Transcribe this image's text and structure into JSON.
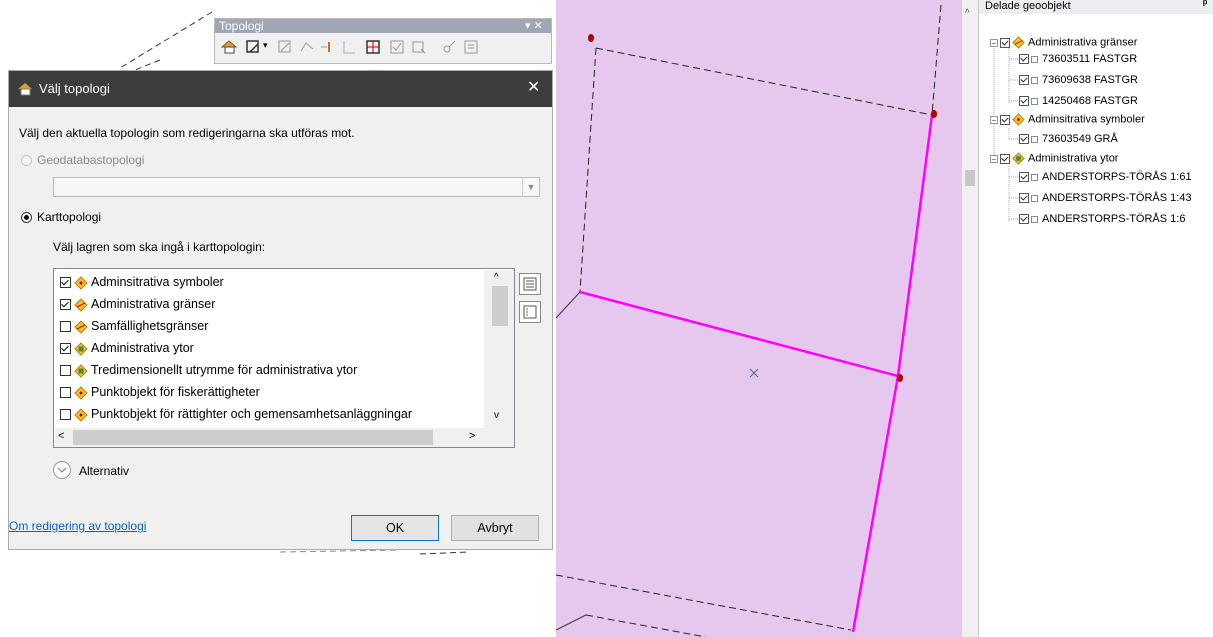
{
  "toolbar": {
    "title": "Topologi",
    "controls": "▾ ✕",
    "icons": [
      "topology-layer-icon",
      "topology-edit-tool-icon",
      "dropdown-arrow-icon",
      "modify-edge-icon",
      "reshape-edge-icon",
      "align-edge-icon",
      "generalize-icon",
      "show-shared-features-icon",
      "validate-icon",
      "error-inspector-icon",
      "fix-topology-icon",
      "topology-properties-icon"
    ]
  },
  "dialog": {
    "title": "Välj topologi",
    "close_glyph": "✕",
    "instruction": "Välj den aktuella topologin som redigeringarna ska utföras mot.",
    "option_geodatabase": "Geodatabastopologi",
    "option_map": "Karttopologi",
    "selected_option": "Karttopologi",
    "layers_instruction": "Välj lagren som ska ingå i karttopologin:",
    "layers": [
      {
        "label": "Adminsitrativa symboler",
        "checked": true
      },
      {
        "label": "Administrativa gränser",
        "checked": true
      },
      {
        "label": "Samfällighetsgränser",
        "checked": false
      },
      {
        "label": "Administrativa ytor",
        "checked": true
      },
      {
        "label": "Tredimensionellt utrymme för administrativa ytor",
        "checked": false
      },
      {
        "label": "Punktobjekt för fiskerättigheter",
        "checked": false
      },
      {
        "label": "Punktobjekt för rättighter och gemensamhetsanläggningar",
        "checked": false
      }
    ],
    "options_label": "Alternativ",
    "help_link": "Om redigering av topologi",
    "ok_label": "OK",
    "cancel_label": "Avbryt"
  },
  "map": {
    "edge_color": "#ff00ff",
    "fill_color": "#e6c8ef",
    "vertex_color": "#b00000"
  },
  "shared_features": {
    "title": "Delade geoobjekt",
    "pin_glyph": "ᵖ",
    "groups": [
      {
        "name": "Administrativa gränser",
        "items": [
          "73603511 FASTGR",
          "73609638 FASTGR",
          "14250468 FASTGR"
        ]
      },
      {
        "name": "Adminsitrativa symboler",
        "items": [
          "73603549 GRÅ"
        ]
      },
      {
        "name": "Administrativa ytor",
        "items": [
          "ANDERSTORPS-TÖRÅS 1:61",
          "ANDERSTORPS-TÖRÅS 1:43",
          "ANDERSTORPS-TÖRÅS 1:6"
        ]
      }
    ]
  }
}
